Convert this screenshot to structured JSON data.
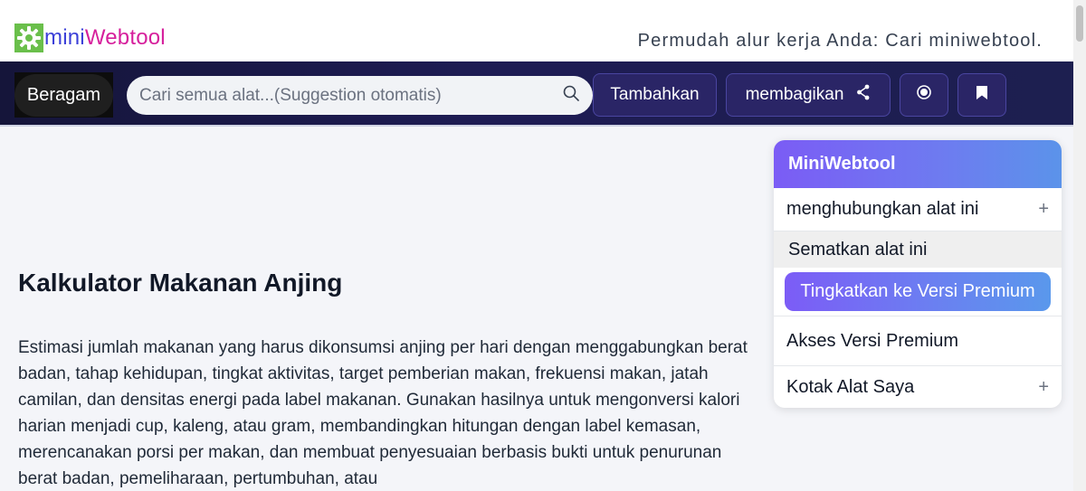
{
  "header": {
    "logo_mini": "mini",
    "logo_web": "Webtool",
    "tagline": "Permudah alur kerja Anda: Cari miniwebtool."
  },
  "nav": {
    "category_label": "Beragam",
    "search_placeholder": "Cari semua alat...(Suggestion otomatis)",
    "add_label": "Tambahkan",
    "share_label": "membagikan"
  },
  "main": {
    "title": "Kalkulator Makanan Anjing",
    "description": "Estimasi jumlah makanan yang harus dikonsumsi anjing per hari dengan menggabungkan berat badan, tahap kehidupan, tingkat aktivitas, target pemberian makan, frekuensi makan, jatah camilan, dan densitas energi pada label makanan. Gunakan hasilnya untuk mengonversi kalori harian menjadi cup, kaleng, atau gram, membandingkan hitungan dengan label kemasan, merencanakan porsi per makan, dan membuat penyesuaian berbasis bukti untuk penurunan berat badan, pemeliharaan, pertumbuhan, atau"
  },
  "sidebar": {
    "title": "MiniWebtool",
    "items": {
      "link_tool": "menghubungkan alat ini",
      "embed_tool": "Sematkan alat ini",
      "upgrade": "Tingkatkan ke Versi Premium",
      "premium_access": "Akses Versi Premium",
      "my_toolbox": "Kotak Alat Saya"
    },
    "plus": "+"
  },
  "colors": {
    "logo_green": "#6abf4b",
    "logo_mini": "#3b3fd8",
    "logo_web": "#d61f9c",
    "nav_bg": "#1e1c54",
    "accent_purple": "#7c5cf6"
  }
}
